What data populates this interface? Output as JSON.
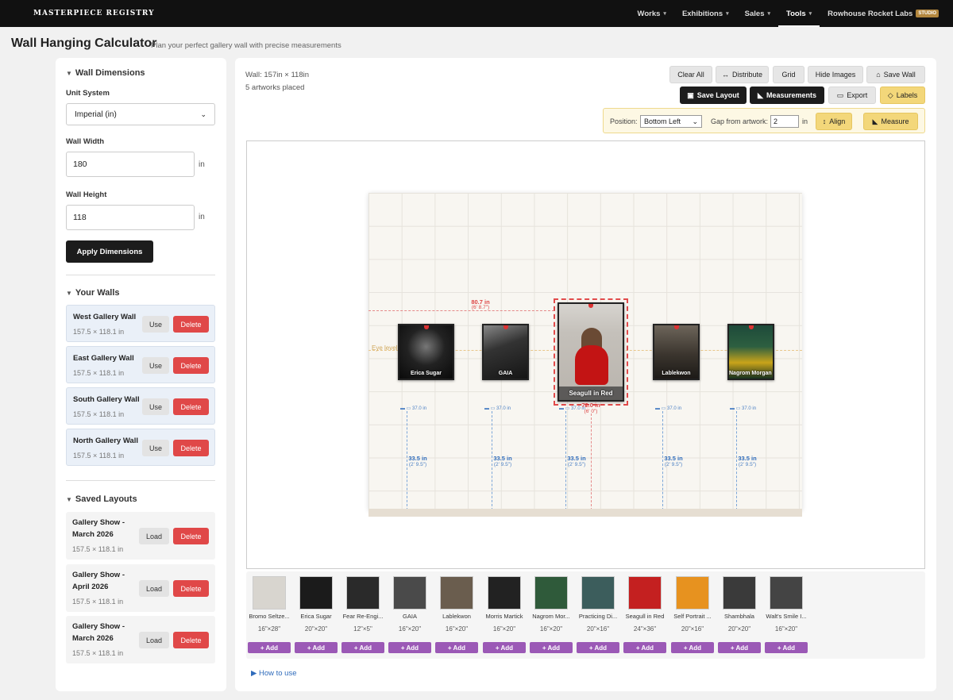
{
  "nav": {
    "brand": "MASTERPIECE REGISTRY",
    "items": [
      {
        "label": "Works"
      },
      {
        "label": "Exhibitions"
      },
      {
        "label": "Sales"
      },
      {
        "label": "Tools"
      }
    ],
    "studio_name": "Rowhouse Rocket Labs",
    "studio_badge": "STUDIO"
  },
  "page": {
    "title": "Wall Hanging Calculator",
    "subtitle": "Plan your perfect gallery wall with precise measurements"
  },
  "sidebar": {
    "dimensions": {
      "heading": "Wall Dimensions",
      "unit_label": "Unit System",
      "unit_value": "Imperial (in)",
      "width_label": "Wall Width",
      "width_value": "180",
      "height_label": "Wall Height",
      "height_value": "118",
      "unit_suffix": "in",
      "apply_label": "Apply Dimensions"
    },
    "walls": {
      "heading": "Your Walls",
      "use_label": "Use",
      "delete_label": "Delete",
      "items": [
        {
          "name": "West Gallery Wall",
          "dims": "157.5 × 118.1 in"
        },
        {
          "name": "East Gallery Wall",
          "dims": "157.5 × 118.1 in"
        },
        {
          "name": "South Gallery Wall",
          "dims": "157.5 × 118.1 in"
        },
        {
          "name": "North Gallery Wall",
          "dims": "157.5 × 118.1 in"
        }
      ]
    },
    "layouts": {
      "heading": "Saved Layouts",
      "load_label": "Load",
      "delete_label": "Delete",
      "items": [
        {
          "name_line1": "Gallery Show -",
          "name_line2": "March 2026",
          "dims": "157.5 × 118.1 in"
        },
        {
          "name_line1": "Gallery Show -",
          "name_line2": "April 2026",
          "dims": "157.5 × 118.1 in"
        },
        {
          "name_line1": "Gallery Show -",
          "name_line2": "March 2026",
          "dims": "157.5 × 118.1 in"
        }
      ]
    }
  },
  "main": {
    "wall_size": "Wall: 157in × 118in",
    "placed_count": "5 artworks placed",
    "toolbar": {
      "clear_all": "Clear All",
      "distribute": "Distribute",
      "grid": "Grid",
      "hide_images": "Hide Images",
      "save_wall": "Save Wall",
      "save_layout": "Save Layout",
      "measurements": "Measurements",
      "export": "Export",
      "labels": "Labels"
    },
    "align": {
      "position_label": "Position:",
      "position_value": "Bottom Left",
      "gap_label": "Gap from artwork:",
      "gap_value": "2",
      "gap_unit": "in",
      "align_btn": "Align",
      "measure_btn": "Measure"
    },
    "canvas": {
      "eye_level_label": "Eye level",
      "top_measure": "80.7 in",
      "top_measure_sub": "(6' 8.7\")",
      "selected_measure": "72.0 in",
      "selected_measure_sub": "(6' 0\")",
      "floor_measure": "33.5 in",
      "floor_measure_sub": "(2' 9.5\")",
      "small_measure": "37.0 in",
      "artworks": [
        {
          "title": "Erica Sugar"
        },
        {
          "title": "GAIA"
        },
        {
          "title": "Seagull in Red"
        },
        {
          "title": "Lablekwon"
        },
        {
          "title": "Nagrom Morgan Monochrome"
        }
      ]
    },
    "tray": {
      "add_label": "+ Add",
      "items": [
        {
          "name": "Bromo Seltze...",
          "size": "16\"×28\"",
          "color": "#d8d5cf"
        },
        {
          "name": "Erica Sugar",
          "size": "20\"×20\"",
          "color": "#1b1b1b"
        },
        {
          "name": "Fear Re-Engi...",
          "size": "12\"×5\"",
          "color": "#2a2a2a"
        },
        {
          "name": "GAIA",
          "size": "16\"×20\"",
          "color": "#4a4a4a"
        },
        {
          "name": "Lablekwon",
          "size": "16\"×20\"",
          "color": "#6a5d4e"
        },
        {
          "name": "Morris Martick",
          "size": "16\"×20\"",
          "color": "#222"
        },
        {
          "name": "Nagrom Mor...",
          "size": "16\"×20\"",
          "color": "#2f5a3a"
        },
        {
          "name": "Practicing Di...",
          "size": "20\"×16\"",
          "color": "#3c5d5c"
        },
        {
          "name": "Seagull in Red",
          "size": "24\"×36\"",
          "color": "#c42020"
        },
        {
          "name": "Self Portrait ...",
          "size": "20\"×16\"",
          "color": "#e7921f"
        },
        {
          "name": "Shambhala",
          "size": "20\"×20\"",
          "color": "#3a3a3a"
        },
        {
          "name": "Walt's Smile I...",
          "size": "16\"×20\"",
          "color": "#444"
        }
      ]
    },
    "how_to": "How to use"
  }
}
